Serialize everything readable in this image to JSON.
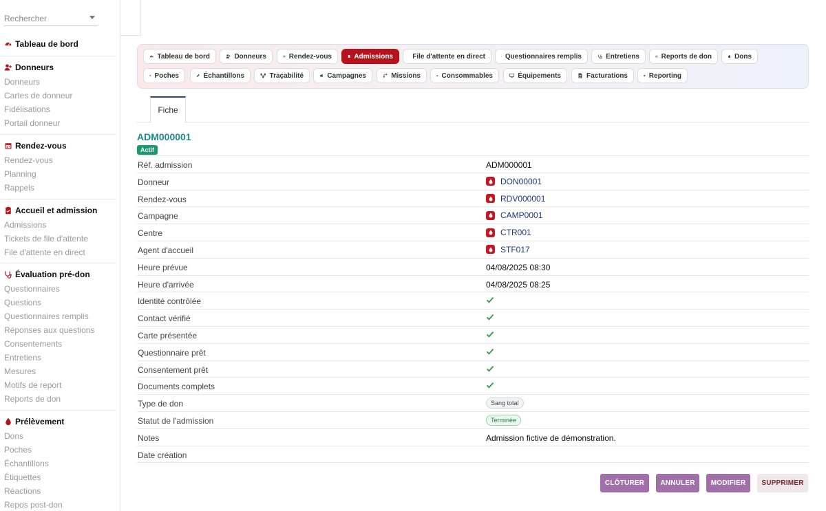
{
  "sidebar": {
    "search_placeholder": "Rechercher",
    "groups": [
      {
        "title": "Tableau de bord",
        "icon": "dashboard-icon",
        "items": []
      },
      {
        "title": "Donneurs",
        "icon": "user-plus-icon",
        "items": [
          "Donneurs",
          "Cartes de donneur",
          "Fidélisations",
          "Portail donneur"
        ]
      },
      {
        "title": "Rendez-vous",
        "icon": "calendar-icon",
        "items": [
          "Rendez-vous",
          "Planning",
          "Rappels"
        ]
      },
      {
        "title": "Accueil et admission",
        "icon": "clipboard-icon",
        "items": [
          "Admissions",
          "Tickets de file d'attente",
          "File d'attente en direct"
        ]
      },
      {
        "title": "Évaluation pré-don",
        "icon": "stethoscope-icon",
        "items": [
          "Questionnaires",
          "Questions",
          "Questionnaires remplis",
          "Réponses aux questions",
          "Consentements",
          "Entretiens",
          "Mesures",
          "Motifs de report",
          "Reports de don"
        ]
      },
      {
        "title": "Prélèvement",
        "icon": "drop-icon",
        "items": [
          "Dons",
          "Poches",
          "Échantillons",
          "Étiquettes",
          "Réactions",
          "Repos post-don"
        ]
      }
    ]
  },
  "tabs": [
    {
      "label": "Tableau de bord",
      "icon": "dashboard-icon",
      "active": false
    },
    {
      "label": "Donneurs",
      "icon": "user-plus-icon",
      "active": false
    },
    {
      "label": "Rendez-vous",
      "icon": "calendar-icon",
      "active": false
    },
    {
      "label": "Admissions",
      "icon": "clipboard-icon",
      "active": true
    },
    {
      "label": "File d'attente en direct",
      "icon": "hourglass-icon",
      "active": false
    },
    {
      "label": "Questionnaires remplis",
      "icon": "form-icon",
      "active": false
    },
    {
      "label": "Entretiens",
      "icon": "stethoscope-icon",
      "active": false
    },
    {
      "label": "Reports de don",
      "icon": "calendar-x-icon",
      "active": false
    },
    {
      "label": "Dons",
      "icon": "drop-icon",
      "active": false
    },
    {
      "label": "Poches",
      "icon": "bag-icon",
      "active": false
    },
    {
      "label": "Échantillons",
      "icon": "pen-icon",
      "active": false
    },
    {
      "label": "Traçabilité",
      "icon": "network-icon",
      "active": false
    },
    {
      "label": "Campagnes",
      "icon": "megaphone-icon",
      "active": false
    },
    {
      "label": "Missions",
      "icon": "route-icon",
      "active": false
    },
    {
      "label": "Consommables",
      "icon": "boxes-icon",
      "active": false
    },
    {
      "label": "Équipements",
      "icon": "monitor-icon",
      "active": false
    },
    {
      "label": "Facturations",
      "icon": "invoice-icon",
      "active": false
    },
    {
      "label": "Reporting",
      "icon": "pie-icon",
      "active": false
    }
  ],
  "detail_tab": "Fiche",
  "record": {
    "title": "ADM000001",
    "status_badge": "Actif",
    "fields": [
      {
        "label": "Réf. admission",
        "type": "text",
        "value": "ADM000001"
      },
      {
        "label": "Donneur",
        "type": "link",
        "value": "DON00001"
      },
      {
        "label": "Rendez-vous",
        "type": "link",
        "value": "RDV000001"
      },
      {
        "label": "Campagne",
        "type": "link",
        "value": "CAMP0001"
      },
      {
        "label": "Centre",
        "type": "link",
        "value": "CTR001"
      },
      {
        "label": "Agent d'accueil",
        "type": "link",
        "value": "STF017"
      },
      {
        "label": "Heure prévue",
        "type": "text",
        "value": "04/08/2025 08:30"
      },
      {
        "label": "Heure d'arrivée",
        "type": "text",
        "value": "04/08/2025 08:25"
      },
      {
        "label": "Identité contrôlée",
        "type": "check",
        "value": true
      },
      {
        "label": "Contact vérifié",
        "type": "check",
        "value": true
      },
      {
        "label": "Carte présentée",
        "type": "check",
        "value": true
      },
      {
        "label": "Questionnaire prêt",
        "type": "check",
        "value": true
      },
      {
        "label": "Consentement prêt",
        "type": "check",
        "value": true
      },
      {
        "label": "Documents complets",
        "type": "check",
        "value": true
      },
      {
        "label": "Type de don",
        "type": "pill",
        "value": "Sang total"
      },
      {
        "label": "Statut de l'admission",
        "type": "pill-green",
        "value": "Terminée"
      },
      {
        "label": "Notes",
        "type": "text",
        "value": "Admission fictive de démonstration."
      },
      {
        "label": "Date création",
        "type": "text",
        "value": ""
      }
    ]
  },
  "actions": {
    "close": "CLÔTURER",
    "cancel": "ANNULER",
    "edit": "MODIFIER",
    "delete": "SUPPRIMER"
  },
  "colors": {
    "brand_red": "#b5121b",
    "title_teal": "#1f8a8a",
    "action_purple": "#a170aa"
  }
}
